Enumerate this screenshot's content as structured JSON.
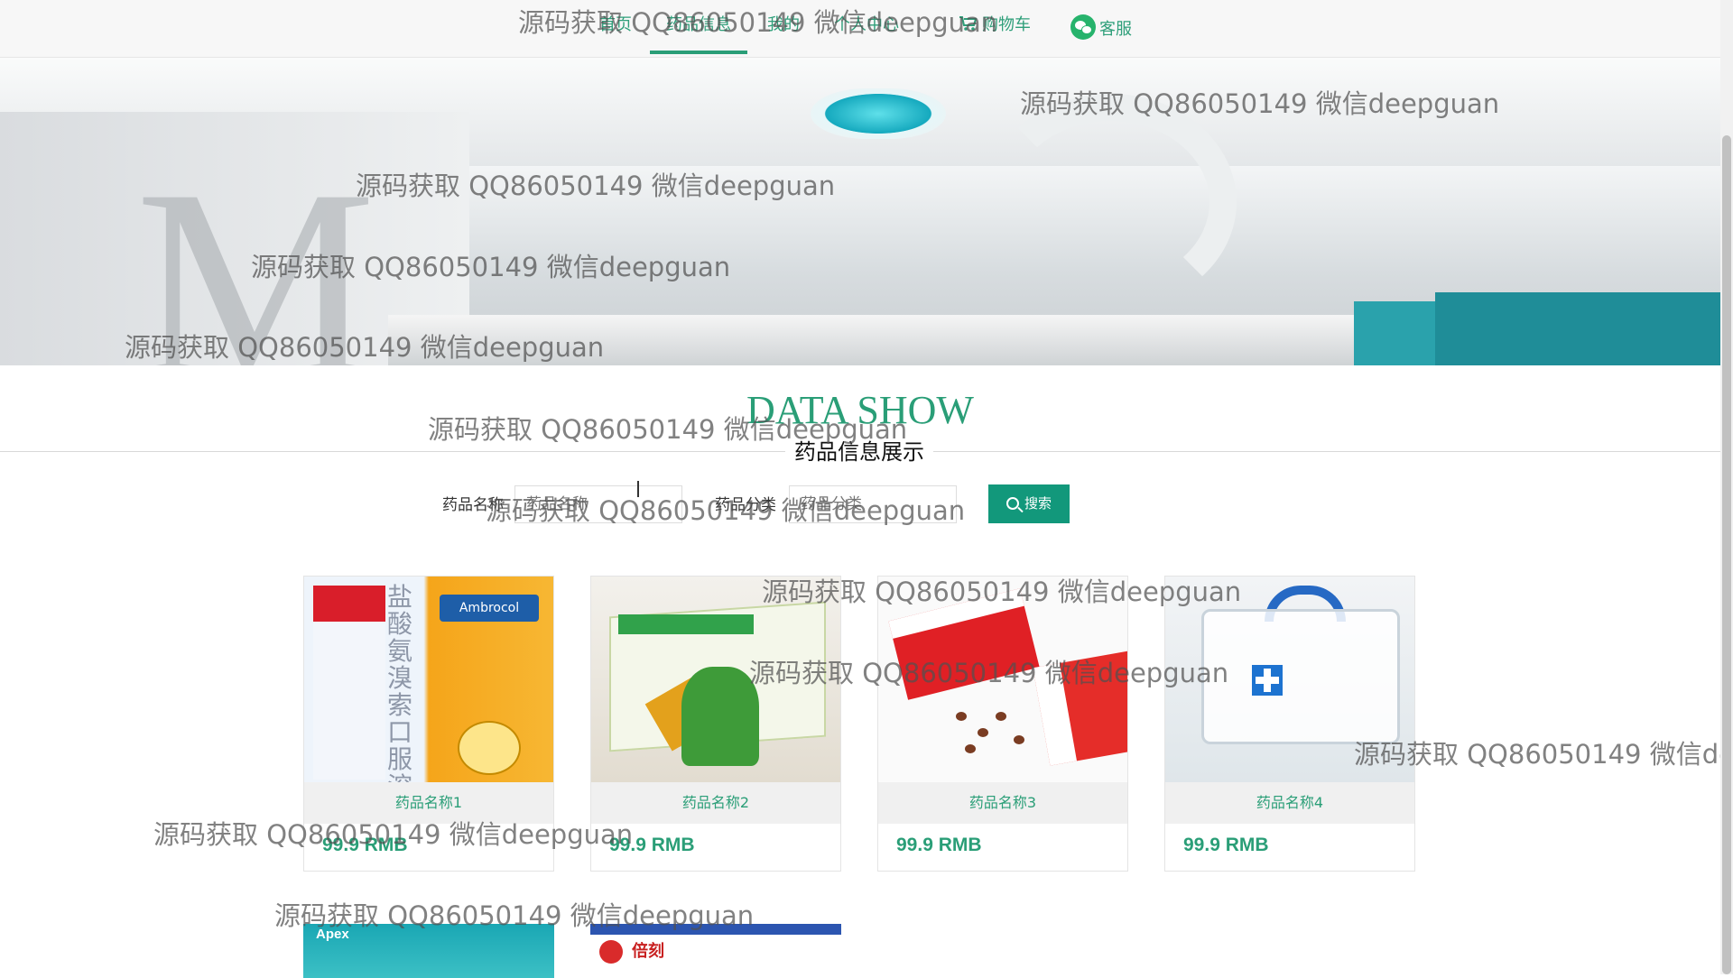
{
  "nav": {
    "home": "首页",
    "drug_info": "药品信息",
    "my": "我的",
    "personal_center": "个人中心",
    "cart": "购物车",
    "service": "客服"
  },
  "section": {
    "title": "DATA SHOW",
    "subtitle": "药品信息展示"
  },
  "search": {
    "name_label": "药品名称",
    "name_placeholder": "药品名称",
    "category_label": "药品分类",
    "category_placeholder": "药品分类",
    "button_label": "搜索"
  },
  "products": [
    {
      "name": "药品名称1",
      "price": "99.9 RMB"
    },
    {
      "name": "药品名称2",
      "price": "99.9 RMB"
    },
    {
      "name": "药品名称3",
      "price": "99.9 RMB"
    },
    {
      "name": "药品名称4",
      "price": "99.9 RMB"
    }
  ],
  "partial_products": {
    "p5_brand": "Apex",
    "p6_brand": "倍刻"
  },
  "watermark": "源码获取 QQ86050149 微信deepguan",
  "colors": {
    "accent": "#2a9e77",
    "button": "#12987b",
    "nav_bg": "#f7f7f7"
  },
  "icons": {
    "cart": "cart-icon",
    "service": "wechat-icon",
    "search": "search-icon"
  }
}
